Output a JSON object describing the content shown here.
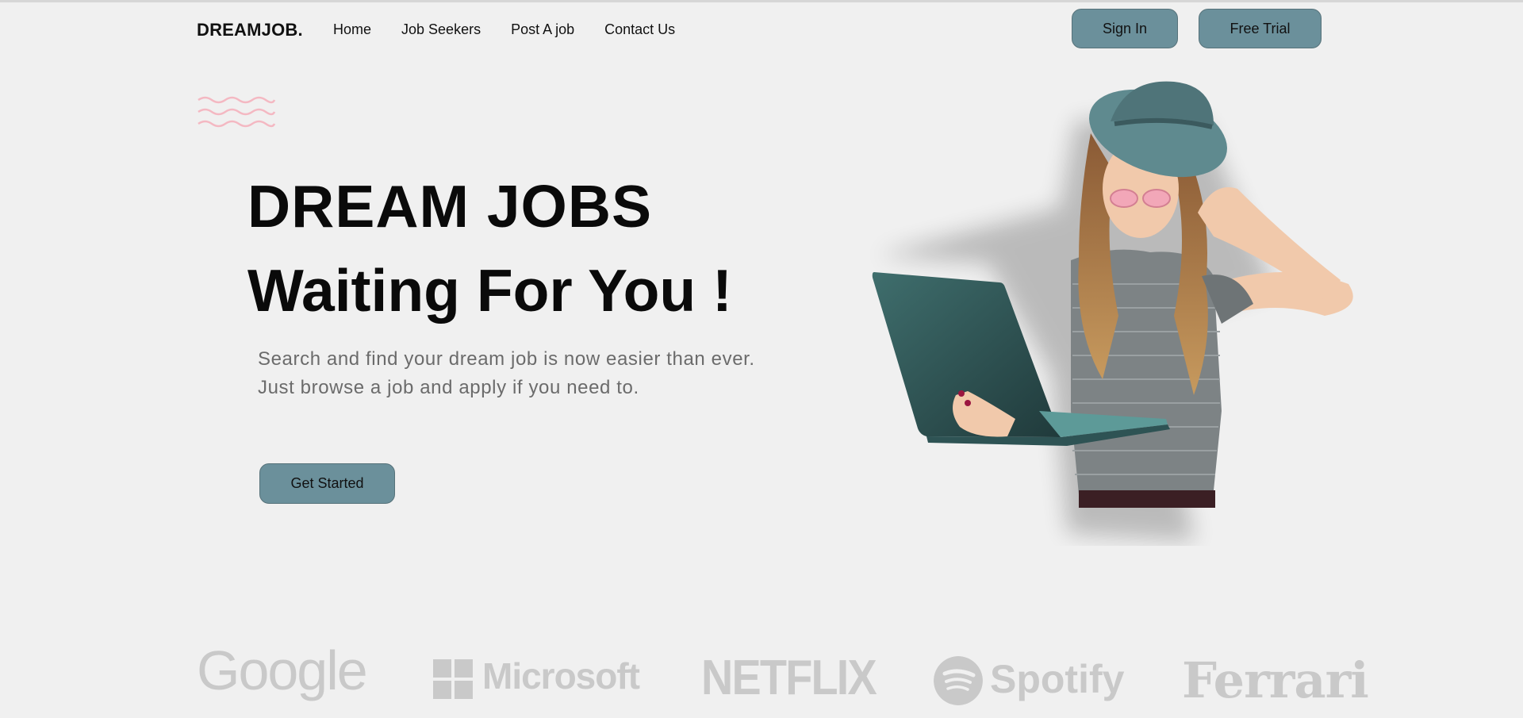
{
  "brand": {
    "logo": "DREAMJOB."
  },
  "nav": {
    "links": [
      "Home",
      "Job Seekers",
      "Post A job",
      "Contact Us"
    ],
    "sign_in": "Sign In",
    "free_trial": "Free Trial"
  },
  "hero": {
    "title_line1": "DREAM JOBS",
    "title_line2": "Waiting For You !",
    "subtitle_line1": "Search and find your dream job is now easier than ever.",
    "subtitle_line2": "Just browse a job and apply if you need to.",
    "cta": "Get Started"
  },
  "partners": {
    "logos": [
      "Google",
      "Microsoft",
      "NETFLIX",
      "Spotify",
      "Ferrari"
    ]
  },
  "colors": {
    "background": "#f0f0f0",
    "button": "#6b909b",
    "accent_waves": "#f4b8c2",
    "partner_logo": "#c9c9c9"
  },
  "icons": {
    "waves": "wave-decoration-icon",
    "microsoft": "microsoft-logo-icon",
    "spotify": "spotify-logo-icon"
  }
}
